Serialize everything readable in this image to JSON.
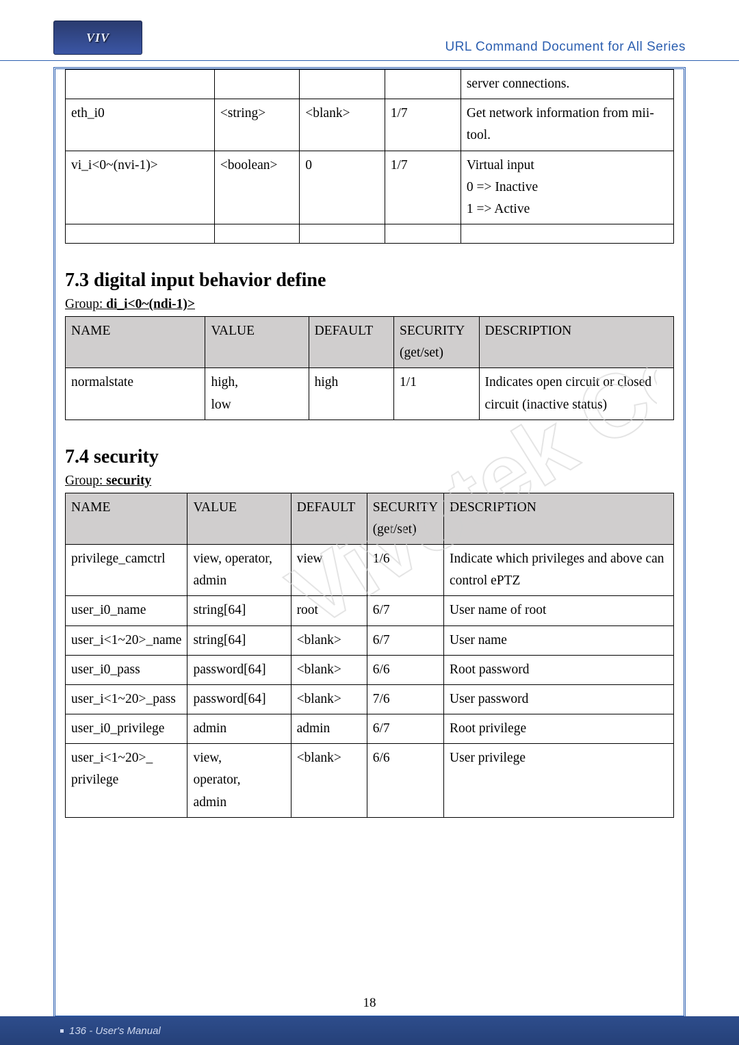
{
  "header": {
    "doc_title": "URL Command Document for All Series",
    "logo_text": "VIV"
  },
  "table1": {
    "rows": [
      {
        "name": "",
        "value": "",
        "default": "",
        "security": "",
        "desc": "server connections."
      },
      {
        "name": "eth_i0",
        "value": "<string>",
        "default": "<blank>",
        "security": "1/7",
        "desc": "Get network information from mii-tool."
      },
      {
        "name": "vi_i<0~(nvi-1)>",
        "value": "<boolean>",
        "default": "0",
        "security": "1/7",
        "desc": "Virtual input\n0 => Inactive\n1 => Active"
      }
    ]
  },
  "section73": {
    "heading": "7.3 digital input behavior define",
    "group_label": "Group: ",
    "group_value": "di_i<0~(ndi-1)>"
  },
  "table2": {
    "headers": {
      "name": "NAME",
      "value": "VALUE",
      "default": "DEFAULT",
      "security": "SECURITY\n(get/set)",
      "desc": "DESCRIPTION"
    },
    "rows": [
      {
        "name": "normalstate",
        "value": "high,\nlow",
        "default": "high",
        "security": "1/1",
        "desc": "Indicates open circuit or closed circuit (inactive status)"
      }
    ]
  },
  "section74": {
    "heading": "7.4 security",
    "group_label": "Group: ",
    "group_value": "security"
  },
  "table3": {
    "headers": {
      "name": "NAME",
      "value": "VALUE",
      "default": "DEFAULT",
      "security": "SECURITY\n(get/set)",
      "desc": "DESCRIPTION"
    },
    "rows": [
      {
        "name": "privilege_camctrl",
        "value": "view, operator,\nadmin",
        "default": "view",
        "security": "1/6",
        "desc": "Indicate which privileges and above can control ePTZ"
      },
      {
        "name": "user_i0_name",
        "value": "string[64]",
        "default": "root",
        "security": "6/7",
        "desc": "User name of root"
      },
      {
        "name": "user_i<1~20>_name",
        "value": "string[64]",
        "default": "<blank>",
        "security": "6/7",
        "desc": "User name"
      },
      {
        "name": "user_i0_pass",
        "value": "password[64]",
        "default": "<blank>",
        "security": "6/6",
        "desc": "Root password"
      },
      {
        "name": "user_i<1~20>_pass",
        "value": "password[64]",
        "default": "<blank>",
        "security": "7/6",
        "desc": "User password"
      },
      {
        "name": "user_i0_privilege",
        "value": "admin",
        "default": "admin",
        "security": "6/7",
        "desc": "Root privilege"
      },
      {
        "name": "user_i<1~20>_\nprivilege",
        "value": "view,\noperator,\nadmin",
        "default": "<blank>",
        "security": "6/6",
        "desc": "User privilege"
      }
    ]
  },
  "footer": {
    "left": "136 - User's Manual",
    "inner_page": "18"
  }
}
